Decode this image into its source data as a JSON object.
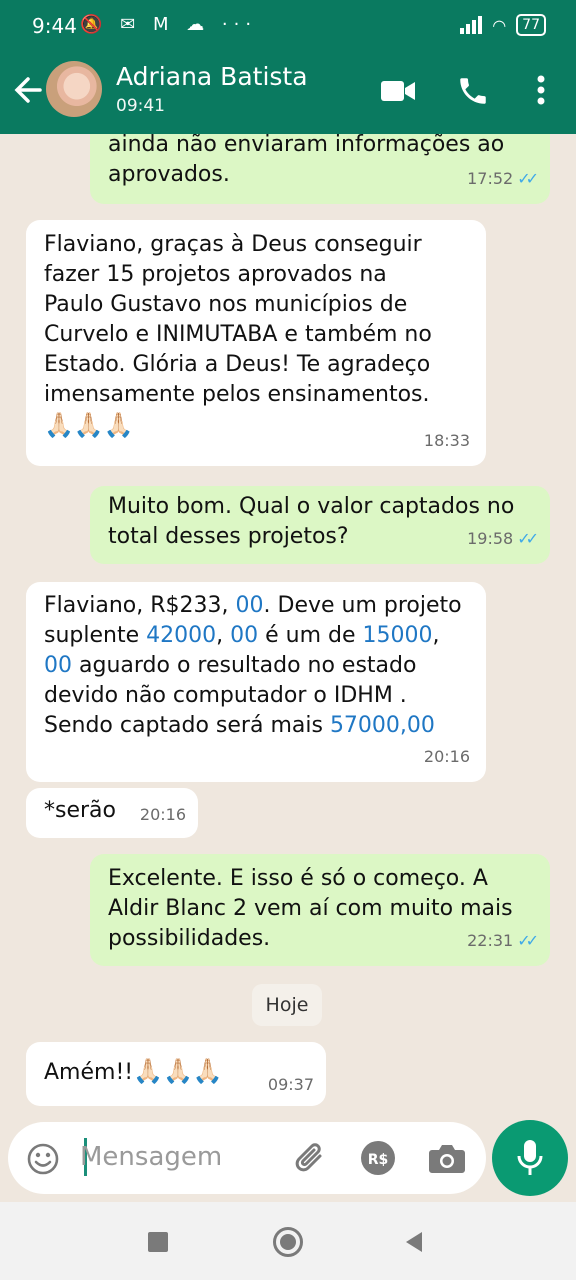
{
  "status_bar": {
    "time": "9:44",
    "battery": "77"
  },
  "header": {
    "contact_name": "Adriana Batista",
    "subtitle": "09:41"
  },
  "messages": [
    {
      "side": "out",
      "text": "ainda não enviaram informações ao\naprovados.",
      "time": "17:52"
    },
    {
      "side": "in",
      "text": "Flaviano, graças à Deus conseguir\nfazer 15 projetos aprovados na\nPaulo Gustavo  nos municípios de\nCurvelo e INIMUTABA e também no\nEstado. Glória a Deus! Te agradeço\nimensamente pelos ensinamentos.",
      "emoji": "🙏🏻🙏🏻🙏🏻",
      "time": "18:33"
    },
    {
      "side": "out",
      "text": "Muito bom. Qual o valor captados no\ntotal desses projetos?",
      "time": "19:58"
    },
    {
      "side": "in",
      "parts": [
        "Flaviano, R$233, ",
        "00",
        ". Deve um projeto\nsuplente ",
        "42000",
        ", ",
        "00",
        " é um de ",
        "15000",
        ",\n",
        "00",
        " aguardo o resultado no estado\ndevido não computador o IDHM .\nSendo captado será mais ",
        "57000,00"
      ],
      "time": "20:16"
    },
    {
      "side": "in",
      "text": "*serão",
      "time": "20:16"
    },
    {
      "side": "out",
      "text": "Excelente. E isso é só o começo. A\nAldir Blanc 2 vem aí com muito mais\npossibilidades.",
      "time": "22:31"
    },
    {
      "side": "in",
      "text": "Amém!!",
      "emoji": "🙏🏻🙏🏻🙏🏻",
      "time": "09:37"
    }
  ],
  "day_separator": "Hoje",
  "input": {
    "placeholder": "Mensagem"
  },
  "colors": {
    "header": "#0a7a60",
    "outgoing": "#dcf7c5",
    "incoming": "#ffffff",
    "accent": "#0a9a72",
    "read_ticks": "#3fa9e8"
  },
  "icons": [
    "back-arrow-icon",
    "video-call-icon",
    "phone-call-icon",
    "more-vert-icon",
    "emoji-icon",
    "attach-icon",
    "pix-icon",
    "camera-icon",
    "mic-icon",
    "nav-square-icon",
    "nav-home-icon",
    "nav-back-icon"
  ]
}
